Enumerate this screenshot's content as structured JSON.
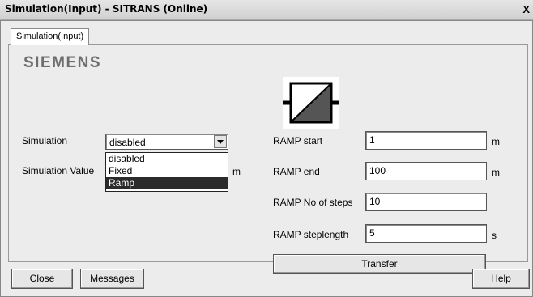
{
  "window": {
    "title": "Simulation(Input) - SITRANS  (Online)",
    "close_label": "X"
  },
  "tab": {
    "label": "Simulation(Input)"
  },
  "logo": "SIEMENS",
  "simulation": {
    "label": "Simulation",
    "selected": "disabled",
    "options": [
      "disabled",
      "Fixed",
      "Ramp"
    ],
    "highlighted_option": "Ramp"
  },
  "simulation_value": {
    "label": "Simulation Value",
    "unit": "m"
  },
  "ramp": {
    "start": {
      "label": "RAMP start",
      "value": "1",
      "unit": "m"
    },
    "end": {
      "label": "RAMP end",
      "value": "100",
      "unit": "m"
    },
    "steps": {
      "label": "RAMP No of steps",
      "value": "10"
    },
    "steplength": {
      "label": "RAMP steplength",
      "value": "5",
      "unit": "s"
    }
  },
  "buttons": {
    "transfer": "Transfer",
    "close": "Close",
    "messages": "Messages",
    "help": "Help"
  },
  "icon": "ramp-function-block-icon"
}
